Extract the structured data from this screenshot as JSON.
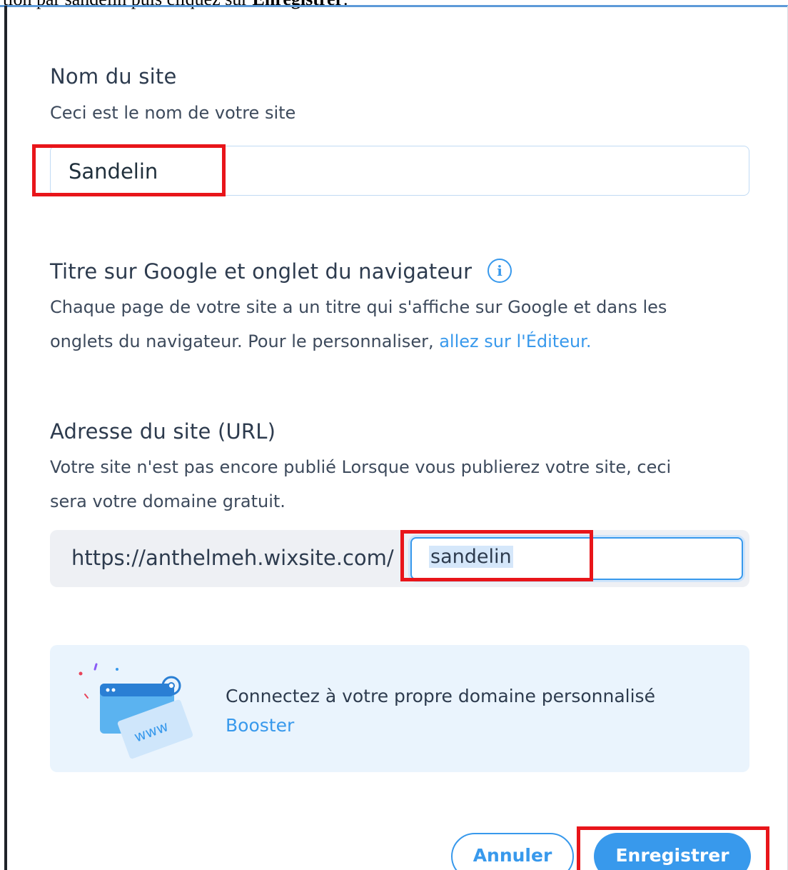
{
  "caption": {
    "prefix": "tion par sandelin puis cliquez sur ",
    "bold": "Enregistrer",
    "suffix": "."
  },
  "site_name": {
    "title": "Nom du site",
    "description": "Ceci est le nom de votre site",
    "value": "Sandelin"
  },
  "seo_title": {
    "title": "Titre sur Google et onglet du navigateur",
    "info_icon": "info-icon",
    "description_line1": "Chaque page de votre site a un titre qui s'affiche sur Google et dans les",
    "description_line2": "onglets du navigateur. Pour le personnaliser, ",
    "link_text": "allez sur l'Éditeur."
  },
  "site_url": {
    "title": "Adresse du site (URL)",
    "description_line1": "Votre site n'est pas encore publié Lorsque vous publierez votre site, ceci",
    "description_line2": "sera votre domaine gratuit.",
    "prefix": "https://anthelmeh.wixsite.com/",
    "value": "sandelin"
  },
  "promo": {
    "illustration": "browser-www-icon",
    "illustration_text": "www",
    "text": "Connectez à votre propre domaine personnalisé",
    "link": "Booster"
  },
  "footer": {
    "cancel_label": "Annuler",
    "save_label": "Enregistrer"
  },
  "colors": {
    "accent": "#3899ec",
    "highlight": "#e8151a",
    "promo_bg": "#eaf4fd"
  }
}
